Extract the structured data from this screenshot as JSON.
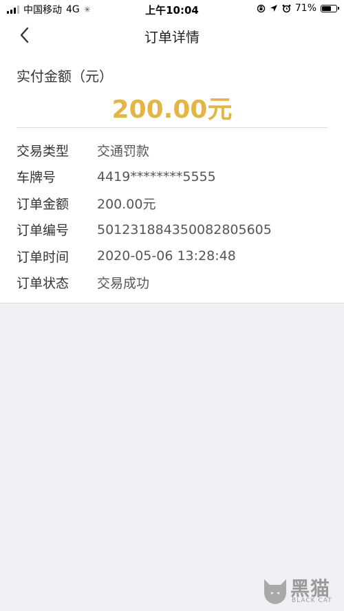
{
  "status_bar": {
    "carrier": "中国移动",
    "network": "4G",
    "time": "上午10:04",
    "battery": "71%",
    "battery_level": 0.71
  },
  "nav": {
    "title": "订单详情"
  },
  "payment": {
    "amount_label": "实付金额（元）",
    "amount_value": "200.00元"
  },
  "details": [
    {
      "label": "交易类型",
      "value": "交通罚款"
    },
    {
      "label": "车牌号",
      "value": "4419********5555"
    },
    {
      "label": "订单金额",
      "value": "200.00元"
    },
    {
      "label": "订单编号",
      "value": "501231884350082805605"
    },
    {
      "label": "订单时间",
      "value": "2020-05-06 13:28:48"
    },
    {
      "label": "订单状态",
      "value": "交易成功"
    }
  ],
  "watermark": {
    "text": "黑猫",
    "subtext": "BLACK CAT"
  },
  "colors": {
    "accent": "#e3b545",
    "background": "#efeff4"
  }
}
